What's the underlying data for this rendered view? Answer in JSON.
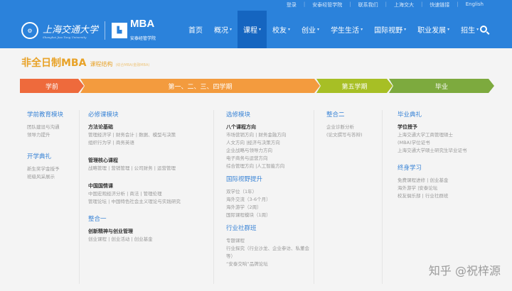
{
  "toplinks": [
    "登录",
    "安泰经管学院",
    "联系我们",
    "上海交大",
    "快速链接",
    "English"
  ],
  "logo": {
    "univ": "上海交通大学",
    "univ_en": "Shanghai Jiao Tong University",
    "mba": "MBA",
    "school": "安泰经管学院"
  },
  "nav": [
    "首页",
    "概况",
    "课程",
    "校友",
    "创业",
    "学生生活",
    "国际视野",
    "职业发展",
    "招生"
  ],
  "page": {
    "title": "非全日制MBA",
    "subtitle": "课程结构",
    "note": "(综合MBA/金融MBA)"
  },
  "stages": [
    {
      "label": "学前",
      "color": "#ee6a3c"
    },
    {
      "label": "第一、二、三、四学期",
      "color": "#f39b3e"
    },
    {
      "label": "第五学期",
      "color": "#a7bf25"
    },
    {
      "label": "毕业",
      "color": "#7daa3e"
    }
  ],
  "col1": {
    "h1": "学前教育模块",
    "l1": [
      "团队建设与沟通",
      "领导力提升"
    ],
    "h2": "开学典礼",
    "l2": [
      "新生奖学金授予",
      "班级风采展示"
    ]
  },
  "col2": {
    "h": "必修课模块",
    "s1": "方法论基础",
    "l1": [
      "管理经济学  |  财务会计  |  数据、模型与决策",
      "组织行为学  |  商务英语"
    ],
    "s2": "管理核心课程",
    "l2": [
      "战略管理  |  营销管理  |  公司财务  |  运营管理"
    ],
    "s3": "中国国情课",
    "l3": [
      "中国宏观经济分析  |  商法  |  管理伦理",
      "管理论坛  |  中国特色社会主义理论与实践研究"
    ],
    "h2": "整合一",
    "s4": "创新精神与创业管理",
    "l4": [
      "创业课程  |  创业活动  |  创业基金"
    ]
  },
  "col3": {
    "h": "选修模块",
    "s1": "八个课程方向",
    "l1": [
      "市场营销方向  |  财务金融方向",
      "人文方向  |经济与决策方向",
      "企业战略与领导力方向",
      "电子商务与运营方向",
      "综合管理方向  |人工智能方向"
    ],
    "h2": "国际视野提升",
    "l2": [
      "双学位（1年）",
      "海外交流（3-6个月）",
      "海外游学（2周）",
      "国际课程模块（1周）"
    ],
    "h3": "行业社群班",
    "l3": [
      "专题课程",
      "行业探究（行业沙龙、企业参访、私董会等）",
      "“安泰交响”品牌论坛"
    ]
  },
  "col4": {
    "h": "整合二",
    "l": [
      "企业诊断分析",
      "(论文撰写与答辩)"
    ]
  },
  "col5": {
    "h": "毕业典礼",
    "s": "学位授予",
    "l": [
      "上海交通大学工商管理硕士",
      "(MBA)学位证书",
      "上海交通大学硕士研究生毕业证书"
    ],
    "h2": "终身学习",
    "l2": [
      "免费课程进修  |  创业基金",
      "海外游学  |安泰论坛",
      "校友俱乐部  |  行业社群班"
    ]
  },
  "watermark": "知乎 @祝梓源"
}
